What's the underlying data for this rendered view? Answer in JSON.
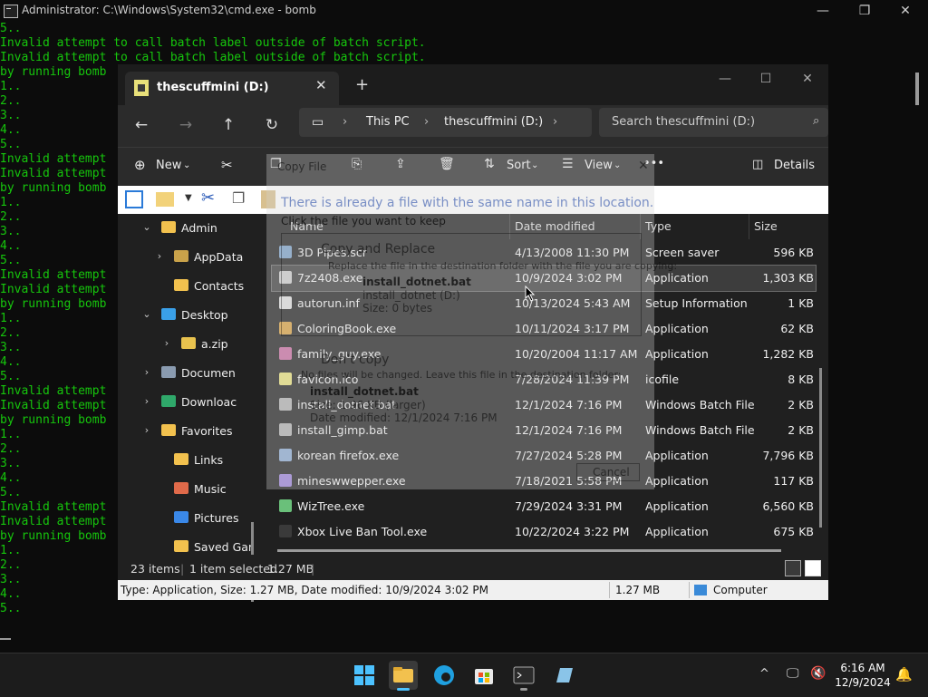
{
  "cmd": {
    "title": "Administrator: C:\\Windows\\System32\\cmd.exe - bomb",
    "lines": [
      "5..",
      "Invalid attempt to call batch label outside of batch script.",
      "Invalid attempt to call batch label outside of batch script.",
      "by running bomb",
      "1..",
      "2..",
      "3..",
      "4..",
      "5..",
      "Invalid attempt",
      "Invalid attempt",
      "by running bomb",
      "1..",
      "2..",
      "3..",
      "4..",
      "5..",
      "Invalid attempt",
      "Invalid attempt",
      "by running bomb",
      "1..",
      "2..",
      "3..",
      "4..",
      "5..",
      "Invalid attempt",
      "Invalid attempt",
      "by running bomb",
      "1..",
      "2..",
      "3..",
      "4..",
      "5..",
      "Invalid attempt",
      "Invalid attempt",
      "by running bomb",
      "1..",
      "2..",
      "3..",
      "4..",
      "5.."
    ]
  },
  "explorer": {
    "tab_title": "thescuffmini (D:)",
    "breadcrumb": [
      "This PC",
      "thescuffmini (D:)"
    ],
    "search_placeholder": "Search thescuffmini (D:)",
    "toolbar": {
      "new_label": "New",
      "sort_label": "Sort",
      "view_label": "View",
      "details_label": "Details",
      "more": "•••"
    },
    "nav": [
      {
        "label": "Admin",
        "chev": "⌄",
        "color": "#f2c14e"
      },
      {
        "label": "AppData",
        "chev": "›",
        "color": "#c9a24a"
      },
      {
        "label": "Contacts",
        "chev": "",
        "color": "#f2c14e"
      },
      {
        "label": "Desktop",
        "chev": "⌄",
        "color": "#3aa0e8"
      },
      {
        "label": "a.zip",
        "chev": "›",
        "color": "#e8c24e"
      },
      {
        "label": "Documen",
        "chev": "›",
        "color": "#8a9bb0"
      },
      {
        "label": "Downloac",
        "chev": "›",
        "color": "#2fa86a"
      },
      {
        "label": "Favorites",
        "chev": "›",
        "color": "#f2c14e"
      },
      {
        "label": "Links",
        "chev": "",
        "color": "#f2c14e"
      },
      {
        "label": "Music",
        "chev": "",
        "color": "#e06a4a"
      },
      {
        "label": "Pictures",
        "chev": "",
        "color": "#3a88e8"
      },
      {
        "label": "Saved Gar",
        "chev": "",
        "color": "#f2c14e"
      }
    ],
    "columns": [
      "Name",
      "Date modified",
      "Type",
      "Size"
    ],
    "files": [
      {
        "name": "3D Pipes.scr",
        "date": "4/13/2008 11:30 PM",
        "type": "Screen saver",
        "size": "596 KB",
        "color": "#7aa0c8"
      },
      {
        "name": "7z2408.exe",
        "date": "10/9/2024 3:02 PM",
        "type": "Application",
        "size": "1,303 KB",
        "color": "#cccccc"
      },
      {
        "name": "autorun.inf",
        "date": "10/13/2024 5:43 AM",
        "type": "Setup Information",
        "size": "1 KB",
        "color": "#dddddd"
      },
      {
        "name": "ColoringBook.exe",
        "date": "10/11/2024 3:17 PM",
        "type": "Application",
        "size": "62 KB",
        "color": "#d8a040"
      },
      {
        "name": "family_guy.exe",
        "date": "10/20/2004 11:17 AM",
        "type": "Application",
        "size": "1,282 KB",
        "color": "#c86aa0"
      },
      {
        "name": "favicon.ico",
        "date": "7/28/2024 11:39 PM",
        "type": "icofile",
        "size": "8 KB",
        "color": "#e8e07a"
      },
      {
        "name": "install_dotnet.bat",
        "date": "12/1/2024 7:16 PM",
        "type": "Windows Batch File",
        "size": "2 KB",
        "color": "#b0b0b0"
      },
      {
        "name": "install_gimp.bat",
        "date": "12/1/2024 7:16 PM",
        "type": "Windows Batch File",
        "size": "2 KB",
        "color": "#b0b0b0"
      },
      {
        "name": "korean firefox.exe",
        "date": "7/27/2024 5:28 PM",
        "type": "Application",
        "size": "7,796 KB",
        "color": "#8aa8d0"
      },
      {
        "name": "mineswwepper.exe",
        "date": "7/18/2021 5:58 PM",
        "type": "Application",
        "size": "117 KB",
        "color": "#9a80d8"
      },
      {
        "name": "WizTree.exe",
        "date": "7/29/2024 3:31 PM",
        "type": "Application",
        "size": "6,560 KB",
        "color": "#6ac07a"
      },
      {
        "name": "Xbox Live Ban Tool.exe",
        "date": "10/22/2024 3:22 PM",
        "type": "Application",
        "size": "675 KB",
        "color": "#3a3a3a"
      }
    ],
    "selected_index": 1,
    "status": {
      "items": "23 items",
      "selected": "1 item selected",
      "size": "1.27 MB"
    },
    "classic_status": {
      "info": "Type: Application, Size: 1.27 MB, Date modified: 10/9/2024 3:02 PM",
      "size": "1.27 MB",
      "location": "Computer"
    }
  },
  "dialog_ghost": {
    "title": "Copy File",
    "message": "There is already a file with the same name in this location.",
    "instruction": "Click the file you want to keep",
    "replace_title": "Copy and Replace",
    "replace_desc": "Replace the file in the destination folder with the file you are copying:",
    "file_name": "install_dotnet.bat",
    "file_loc": "install_dotnet (D:)",
    "file_size": "Size: 0 bytes",
    "dont_copy_title": "Don't copy",
    "dont_copy_desc": "No files will be changed. Leave this file in the destination folder:",
    "file2_name": "install_dotnet.bat",
    "file2_size": "Size: 1.96 KB (larger)",
    "file2_date": "Date modified: 12/1/2024 7:16 PM",
    "cancel": "Cancel"
  },
  "taskbar": {
    "time": "6:16 AM",
    "date": "12/9/2024"
  }
}
